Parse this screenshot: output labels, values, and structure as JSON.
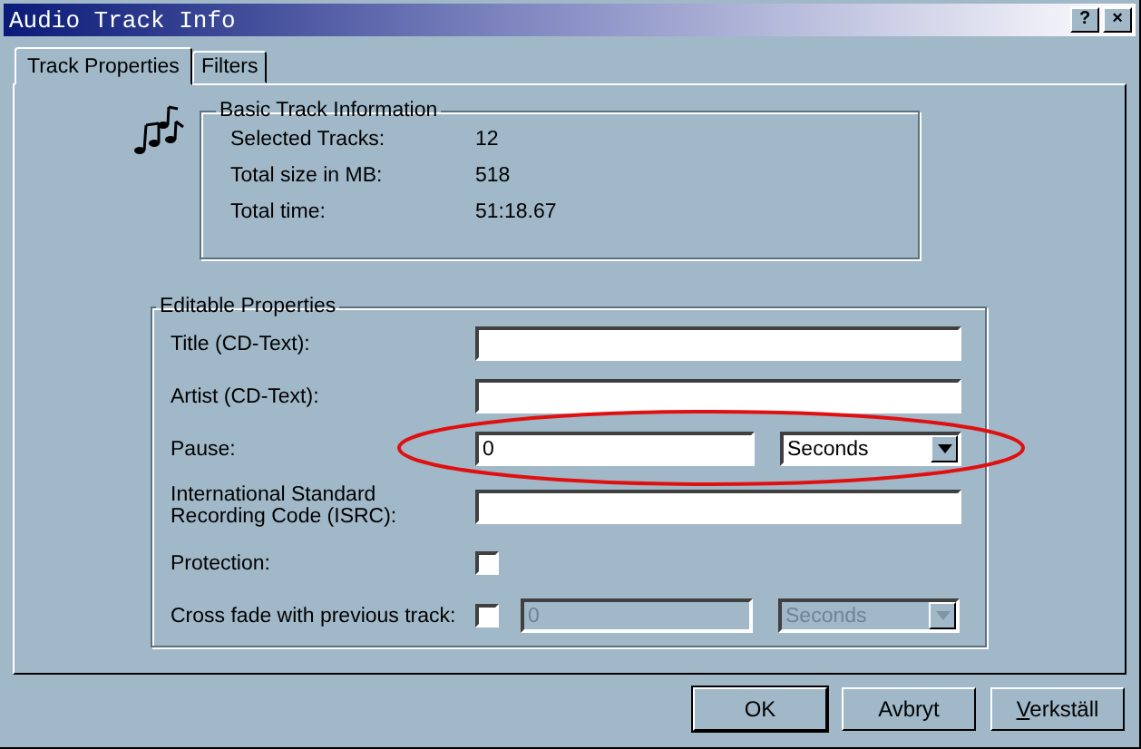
{
  "window": {
    "title": "Audio Track Info",
    "controls": [
      "?",
      "×"
    ]
  },
  "tabs": [
    {
      "label": "Track Properties",
      "selected": true
    },
    {
      "label": "Filters",
      "selected": false
    }
  ],
  "basic_info": {
    "title": "Basic Track Information",
    "rows": [
      {
        "label": "Selected Tracks:",
        "value": "12"
      },
      {
        "label": "Total size in MB:",
        "value": "518"
      },
      {
        "label": "Total time:",
        "value": "51:18.67"
      }
    ]
  },
  "editable": {
    "title": "Editable Properties",
    "rows": [
      {
        "kind": "text",
        "label": "Title (CD-Text):",
        "value": ""
      },
      {
        "kind": "text",
        "label": "Artist (CD-Text):",
        "value": ""
      },
      {
        "kind": "duration",
        "label": "Pause:",
        "value": "0",
        "unit": "Seconds",
        "disabled": false,
        "highlighted": true
      },
      {
        "kind": "text",
        "label": "International Standard Recording Code (ISRC):",
        "value": ""
      },
      {
        "kind": "checkbox",
        "label": "Protection:",
        "checked": false
      },
      {
        "kind": "checkbox_duration",
        "label": "Cross fade with previous track:",
        "checked": false,
        "value": "0",
        "unit": "Seconds",
        "disabled": true
      }
    ]
  },
  "buttons": [
    {
      "label": "OK",
      "default": true
    },
    {
      "label": "Avbryt",
      "default": false
    },
    {
      "label": "Verkställ",
      "default": false,
      "first_letter_underlined": true
    }
  ]
}
